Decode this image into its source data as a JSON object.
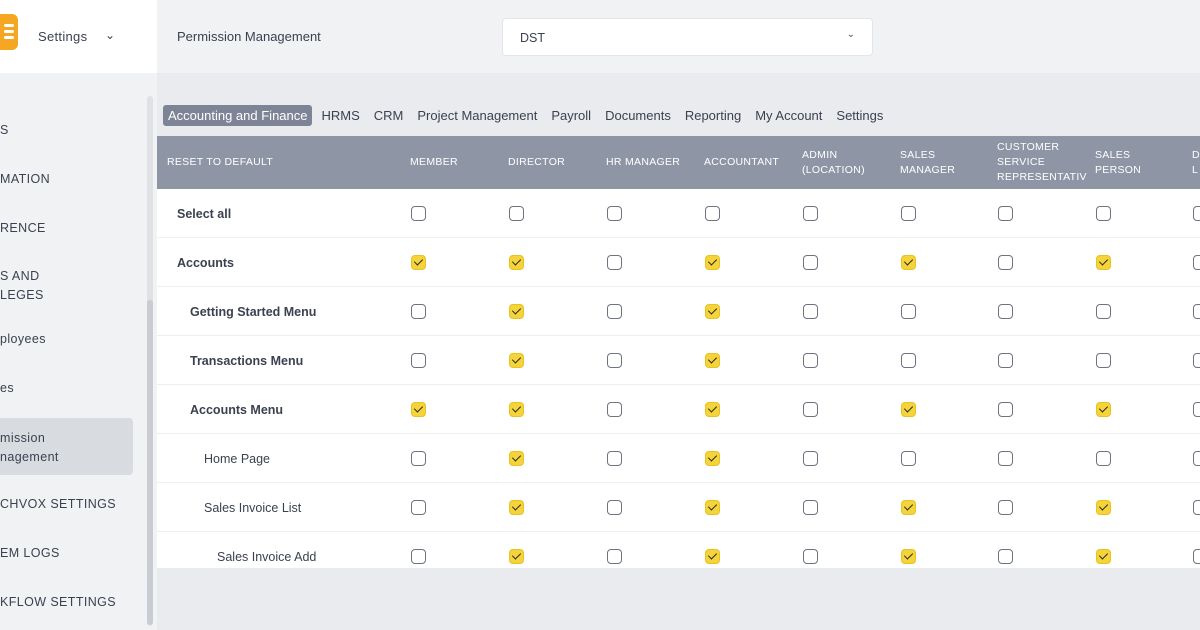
{
  "sidebar": {
    "title": "Settings",
    "items": [
      {
        "label": "S"
      },
      {
        "label": "MATION"
      },
      {
        "label": "RENCE"
      },
      {
        "label": "S AND",
        "label2": "LEGES"
      },
      {
        "label": "ployees"
      },
      {
        "label": "es"
      },
      {
        "label": "mission",
        "label2": "nagement"
      },
      {
        "label": "CHVOX SETTINGS"
      },
      {
        "label": "EM LOGS"
      },
      {
        "label": "KFLOW SETTINGS"
      }
    ]
  },
  "topbar": {
    "title": "Permission Management",
    "select_value": "DST"
  },
  "tabs": [
    "Accounting and Finance",
    "HRMS",
    "CRM",
    "Project Management",
    "Payroll",
    "Documents",
    "Reporting",
    "My Account",
    "Settings"
  ],
  "table": {
    "reset_label": "RESET TO DEFAULT",
    "columns": [
      {
        "l1": "MEMBER",
        "l2": "",
        "l3": ""
      },
      {
        "l1": "DIRECTOR",
        "l2": "",
        "l3": ""
      },
      {
        "l1": "HR MANAGER",
        "l2": "",
        "l3": ""
      },
      {
        "l1": "ACCOUNTANT",
        "l2": "",
        "l3": ""
      },
      {
        "l1": "ADMIN",
        "l2": "(LOCATION)",
        "l3": ""
      },
      {
        "l1": "SALES",
        "l2": "MANAGER",
        "l3": ""
      },
      {
        "l1": "CUSTOMER",
        "l2": "SERVICE",
        "l3": "REPRESENTATIV"
      },
      {
        "l1": "SALES",
        "l2": "PERSON",
        "l3": ""
      },
      {
        "l1": "D",
        "l2": "L",
        "l3": ""
      }
    ],
    "rows": [
      {
        "label": "Select all",
        "level": 0,
        "checks": [
          false,
          false,
          false,
          false,
          false,
          false,
          false,
          false,
          false
        ]
      },
      {
        "label": "Accounts",
        "level": 0,
        "checks": [
          true,
          true,
          false,
          true,
          false,
          true,
          false,
          true,
          false
        ]
      },
      {
        "label": "Getting Started Menu",
        "level": 1,
        "checks": [
          false,
          true,
          false,
          true,
          false,
          false,
          false,
          false,
          false
        ]
      },
      {
        "label": "Transactions Menu",
        "level": 1,
        "checks": [
          false,
          true,
          false,
          true,
          false,
          false,
          false,
          false,
          false
        ]
      },
      {
        "label": "Accounts Menu",
        "level": 1,
        "checks": [
          true,
          true,
          false,
          true,
          false,
          true,
          false,
          true,
          false
        ]
      },
      {
        "label": "Home Page",
        "level": 2,
        "checks": [
          false,
          true,
          false,
          true,
          false,
          false,
          false,
          false,
          false
        ]
      },
      {
        "label": "Sales Invoice List",
        "level": 2,
        "checks": [
          false,
          true,
          false,
          true,
          false,
          true,
          false,
          true,
          false
        ]
      },
      {
        "label": "Sales Invoice Add",
        "level": 3,
        "checks": [
          false,
          true,
          false,
          true,
          false,
          true,
          false,
          true,
          false
        ]
      }
    ]
  }
}
